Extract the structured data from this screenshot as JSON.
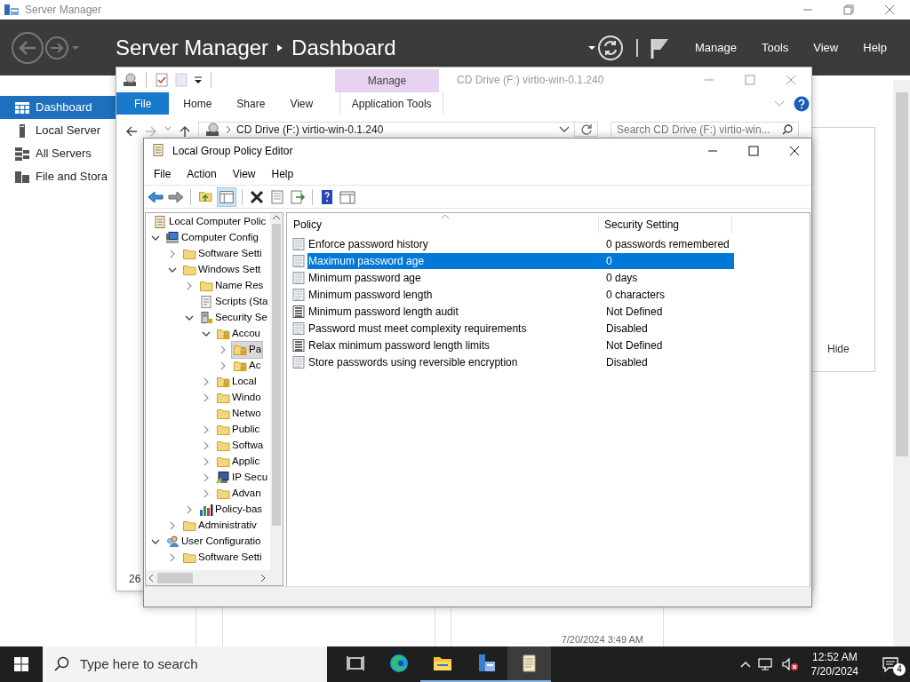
{
  "server_manager": {
    "title": "Server Manager",
    "breadcrumb": [
      "Server Manager",
      "Dashboard"
    ],
    "menu": [
      "Manage",
      "Tools",
      "View",
      "Help"
    ],
    "sidebar": [
      {
        "kind": "dashboard",
        "label": "Dashboard",
        "selected": true
      },
      {
        "kind": "server",
        "label": "Local Server",
        "selected": false
      },
      {
        "kind": "servers",
        "label": "All Servers",
        "selected": false
      },
      {
        "kind": "storage",
        "label": "File and Stora",
        "selected": false
      }
    ],
    "panel_link": "Hide",
    "timestamp": "7/20/2024 3:49 AM"
  },
  "explorer": {
    "contextual_tab": "Manage",
    "title": "CD Drive (F:) virtio-win-0.1.240",
    "tabs": [
      {
        "label": "File",
        "kind": "file"
      },
      {
        "label": "Home",
        "kind": "plain"
      },
      {
        "label": "Share",
        "kind": "plain"
      },
      {
        "label": "View",
        "kind": "plain"
      },
      {
        "label": "Application Tools",
        "kind": "contextual"
      }
    ],
    "address": "CD Drive (F:) virtio-win-0.1.240",
    "search": {
      "placeholder": "Search CD Drive (F:) virtio-win..."
    },
    "status": "26"
  },
  "gpo": {
    "title": "Local Group Policy Editor",
    "menu": [
      "File",
      "Action",
      "View",
      "Help"
    ],
    "tree": {
      "label": "Local Computer Polic",
      "kind": "policy-doc",
      "selected": false,
      "children": [
        {
          "label": "Computer Config",
          "kind": "computer",
          "expanded": true,
          "selected": false,
          "children": [
            {
              "label": "Software Setti",
              "kind": "folder",
              "expanded": false,
              "selected": false
            },
            {
              "label": "Windows Sett",
              "kind": "folder",
              "expanded": true,
              "selected": false,
              "children": [
                {
                  "label": "Name Res",
                  "kind": "folder",
                  "expanded": false,
                  "selected": false
                },
                {
                  "label": "Scripts (Sta",
                  "kind": "script",
                  "selected": false
                },
                {
                  "label": "Security Se",
                  "kind": "security",
                  "expanded": true,
                  "selected": false,
                  "children": [
                    {
                      "label": "Accou",
                      "kind": "lock-folder",
                      "expanded": true,
                      "selected": false,
                      "children": [
                        {
                          "label": "Pa",
                          "kind": "lock-folder",
                          "expanded": false,
                          "selected": true
                        },
                        {
                          "label": "Ac",
                          "kind": "lock-folder",
                          "expanded": false,
                          "selected": false
                        }
                      ]
                    },
                    {
                      "label": "Local",
                      "kind": "lock-folder",
                      "expanded": false,
                      "selected": false
                    },
                    {
                      "label": "Windo",
                      "kind": "folder",
                      "expanded": false,
                      "selected": false
                    },
                    {
                      "label": "Netwo",
                      "kind": "folder",
                      "selected": false
                    },
                    {
                      "label": "Public",
                      "kind": "folder",
                      "expanded": false,
                      "selected": false
                    },
                    {
                      "label": "Softwa",
                      "kind": "folder",
                      "expanded": false,
                      "selected": false
                    },
                    {
                      "label": "Applic",
                      "kind": "folder",
                      "expanded": false,
                      "selected": false
                    },
                    {
                      "label": "IP Secu",
                      "kind": "ipsec",
                      "expanded": false,
                      "selected": false
                    },
                    {
                      "label": "Advan",
                      "kind": "folder",
                      "expanded": false,
                      "selected": false
                    }
                  ]
                },
                {
                  "label": "Policy-bas",
                  "kind": "chart",
                  "expanded": false,
                  "selected": false
                }
              ]
            },
            {
              "label": "Administrativ",
              "kind": "folder",
              "expanded": false,
              "selected": false
            }
          ]
        },
        {
          "label": "User Configuratio",
          "kind": "user",
          "expanded": true,
          "selected": false,
          "children": [
            {
              "label": "Software Setti",
              "kind": "folder",
              "expanded": false,
              "selected": false
            }
          ]
        }
      ]
    },
    "columns": [
      "Policy",
      "Security Setting"
    ],
    "rows": [
      {
        "kind": "policy",
        "policy": "Enforce password history",
        "setting": "0 passwords remembered",
        "selected": false
      },
      {
        "kind": "policy",
        "policy": "Maximum password age",
        "setting": "0",
        "selected": true
      },
      {
        "kind": "policy",
        "policy": "Minimum password age",
        "setting": "0 days",
        "selected": false
      },
      {
        "kind": "policy",
        "policy": "Minimum password length",
        "setting": "0 characters",
        "selected": false
      },
      {
        "kind": "list-policy",
        "policy": "Minimum password length audit",
        "setting": "Not Defined",
        "selected": false
      },
      {
        "kind": "policy",
        "policy": "Password must meet complexity requirements",
        "setting": "Disabled",
        "selected": false
      },
      {
        "kind": "list-policy",
        "policy": "Relax minimum password length limits",
        "setting": "Not Defined",
        "selected": false
      },
      {
        "kind": "policy",
        "policy": "Store passwords using reversible encryption",
        "setting": "Disabled",
        "selected": false
      }
    ]
  },
  "taskbar": {
    "search": {
      "placeholder": "Type here to search"
    },
    "apps": [
      {
        "kind": "task-view",
        "running": false,
        "selected": false
      },
      {
        "kind": "edge",
        "running": false,
        "selected": false
      },
      {
        "kind": "explorer",
        "running": true,
        "selected": false
      },
      {
        "kind": "server-manager",
        "running": true,
        "selected": false
      },
      {
        "kind": "notepad",
        "running": true,
        "selected": true
      }
    ],
    "time": "12:52 AM",
    "date": "7/20/2024",
    "notifications": "4"
  }
}
